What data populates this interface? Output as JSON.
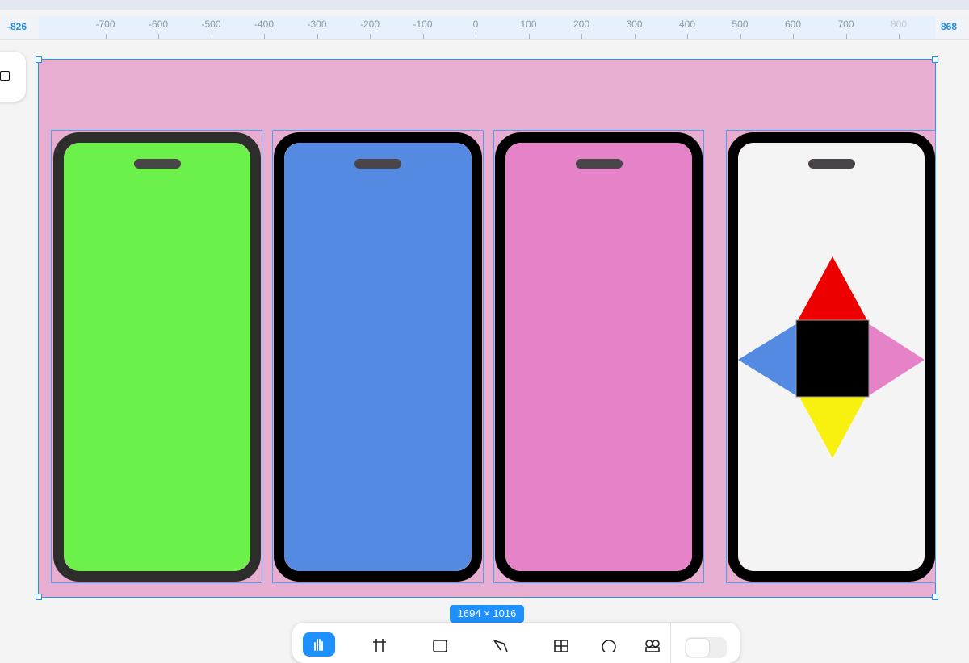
{
  "ruler": {
    "start_label": "-826",
    "end_label": "868",
    "ticks": [
      "-700",
      "-600",
      "-500",
      "-400",
      "-300",
      "-200",
      "-100",
      "0",
      "100",
      "200",
      "300",
      "400",
      "500",
      "600",
      "700",
      "800"
    ]
  },
  "artboard": {
    "size_badge": "1694 × 1016",
    "background": "#e8aed2",
    "selection_color": "#1e90ff"
  },
  "phones": [
    {
      "frame_color": "#2d2d2b",
      "screen_color": "#6cf04a"
    },
    {
      "frame_color": "#000000",
      "screen_color": "#548ae1"
    },
    {
      "frame_color": "#000000",
      "screen_color": "#e683c8"
    },
    {
      "frame_color": "#000000",
      "screen_color": "#f4f4f4"
    }
  ],
  "compass_shape": {
    "top_color": "#ee0000",
    "left_color": "#548ae1",
    "right_color": "#e683c8",
    "bottom_color": "#f8f00e",
    "center_color": "#000000"
  },
  "toolbar": {
    "tools": [
      "hand-tool-icon",
      "frame-tool-icon",
      "rectangle-tool-icon",
      "pen-tool-icon",
      "grid-tool-icon",
      "ellipse-tool-icon",
      "components-tool-icon"
    ],
    "active_tool": "hand-tool-icon"
  }
}
